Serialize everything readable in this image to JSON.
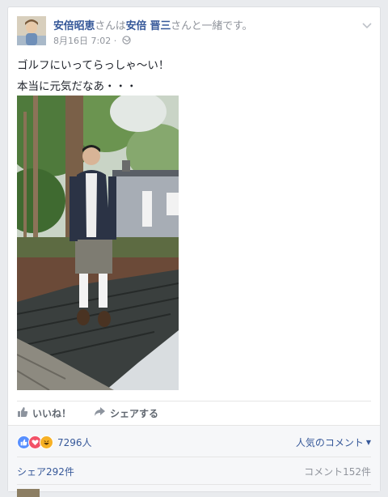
{
  "post": {
    "author": "安倍昭恵",
    "tag_connector": "さんは",
    "tagged": "安倍 晋三",
    "tag_suffix": "さんと一緒です。",
    "timestamp": "8月16日 7:02 · ",
    "privacy_icon": "globe-icon",
    "text_line1": "ゴルフにいってらっしゃ〜い！",
    "text_line2": "本当に元気だなあ・・・"
  },
  "actions": {
    "like_label": "いいね！",
    "share_label": "シェアする"
  },
  "reactions": {
    "icons": [
      "like-icon",
      "love-icon",
      "haha-icon"
    ],
    "count": "7296人",
    "sort_label": "人気のコメント"
  },
  "stats": {
    "shares": "シェア292件",
    "comments": "コメント152件"
  },
  "colors": {
    "link": "#365899",
    "meta": "#90949c",
    "like_blue": "#5890ff",
    "love_red": "#f25268",
    "haha_yellow": "#f7b125"
  }
}
